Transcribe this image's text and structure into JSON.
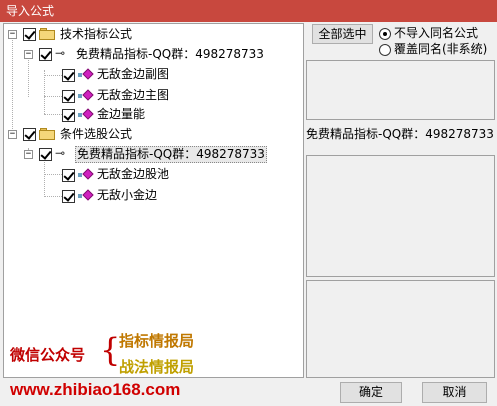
{
  "window": {
    "title": "导入公式"
  },
  "tree": {
    "groups": [
      {
        "label": "技术指标公式",
        "checked": true,
        "icon": "folder-icon",
        "source": {
          "label": "免费精品指标-QQ群：498278733",
          "checked": true,
          "icon": "key-icon",
          "items": [
            {
              "label": "无敌金边副图",
              "checked": true,
              "icon": "gem-icon"
            },
            {
              "label": "无敌金边主图",
              "checked": true,
              "icon": "gem-icon"
            },
            {
              "label": "金边量能",
              "checked": true,
              "icon": "gem-icon"
            }
          ]
        }
      },
      {
        "label": "条件选股公式",
        "checked": true,
        "icon": "folder-icon",
        "source": {
          "label": "免费精品指标-QQ群：498278733",
          "checked": true,
          "icon": "key-icon",
          "items": [
            {
              "label": "无敌金边股池",
              "checked": true,
              "icon": "gem-icon"
            },
            {
              "label": "无敌小金边",
              "checked": true,
              "icon": "gem-icon"
            }
          ]
        }
      }
    ]
  },
  "options": {
    "select_all_label": "全部选中",
    "radio_no_import": "不导入同名公式",
    "radio_overwrite": "覆盖同名(非系统)",
    "selected_radio": "no_import"
  },
  "details": {
    "formula_name": "免费精品指标-QQ群：498278733"
  },
  "watermark": {
    "wechat_label": "微信公众号",
    "brace": "{",
    "name1": "指标情报局",
    "name2": "战法情报局",
    "url": "www.zhibiao168.com"
  },
  "footer": {
    "ok_label": "确定",
    "cancel_label": "取消"
  },
  "colors": {
    "titlebar": "#c8483e",
    "watermark_red": "#c00000",
    "watermark_orange": "#c07800",
    "watermark_gold": "#c0a000",
    "gem": "#d020c0",
    "folder": "#f5d77a"
  }
}
